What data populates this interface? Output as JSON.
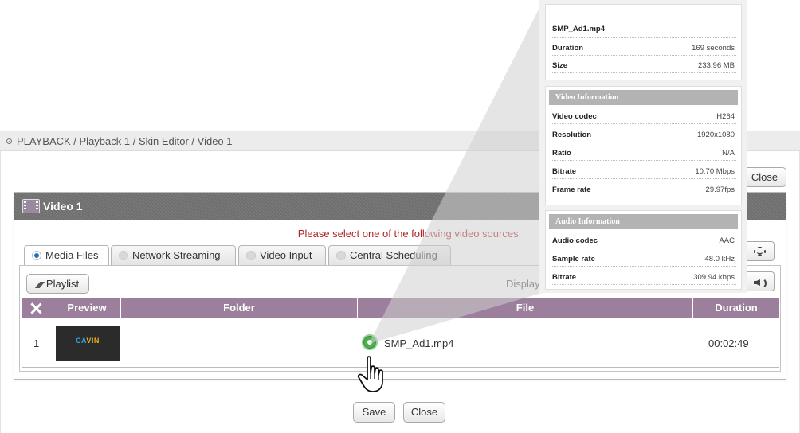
{
  "breadcrumb": {
    "text": "PLAYBACK / Playback 1 / Skin Editor / Video 1"
  },
  "top_close_label": "Close",
  "dialog": {
    "title": "Video 1",
    "notice": "Please select one of the following video sources.",
    "tabs": [
      {
        "label": "Media Files",
        "active": true
      },
      {
        "label": "Network Streaming",
        "active": false
      },
      {
        "label": "Video Input",
        "active": false
      },
      {
        "label": "Central Scheduling",
        "active": false
      }
    ],
    "playlist_label": "Playlist",
    "display_label": "Display",
    "columns": {
      "preview": "Preview",
      "folder": "Folder",
      "file": "File",
      "duration": "Duration"
    },
    "rows": [
      {
        "index": "1",
        "thumb_logo": "CAVIN",
        "folder": "",
        "file": "SMP_Ad1.mp4",
        "duration": "00:02:49"
      }
    ]
  },
  "bottom": {
    "save_label": "Save",
    "close_label": "Close"
  },
  "info_popup": {
    "file_name": "SMP_Ad1.mp4",
    "general": [
      {
        "key": "Duration",
        "value": "169 seconds"
      },
      {
        "key": "Size",
        "value": "233.96 MB"
      }
    ],
    "video_header": "Video Information",
    "video": [
      {
        "key": "Video codec",
        "value": "H264"
      },
      {
        "key": "Resolution",
        "value": "1920x1080"
      },
      {
        "key": "Ratio",
        "value": "N/A"
      },
      {
        "key": "Bitrate",
        "value": "10.70 Mbps"
      },
      {
        "key": "Frame rate",
        "value": "29.97fps"
      }
    ],
    "audio_header": "Audio Information",
    "audio": [
      {
        "key": "Audio codec",
        "value": "AAC"
      },
      {
        "key": "Sample rate",
        "value": "48.0 kHz"
      },
      {
        "key": "Bitrate",
        "value": "309.94 kbps"
      }
    ]
  },
  "colors": {
    "grid_header": "#9b7f9c",
    "dialog_header": "#6f6f6f",
    "notice_text": "#b22222",
    "status_ok": "#4caf50",
    "active_radio": "#1e73be"
  }
}
